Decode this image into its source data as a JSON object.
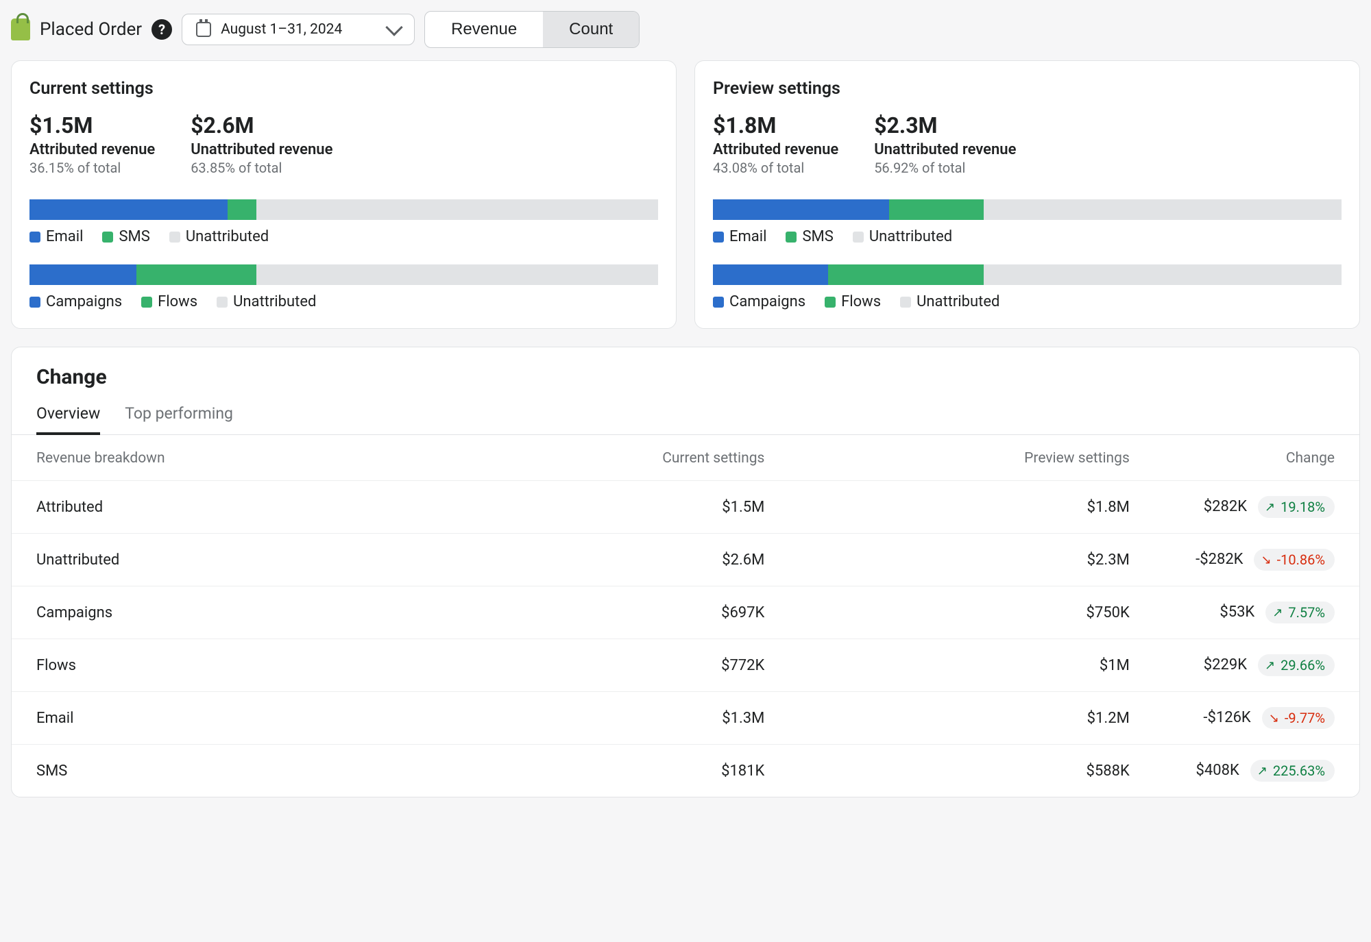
{
  "colors": {
    "blue": "#2c6ecb",
    "green": "#37b26c",
    "gray": "#e1e3e5"
  },
  "header": {
    "brand_label": "Placed Order",
    "date_range": "August 1–31, 2024",
    "segments": {
      "revenue": "Revenue",
      "count": "Count",
      "active": "count"
    }
  },
  "legends": {
    "channel": [
      "Email",
      "SMS",
      "Unattributed"
    ],
    "type": [
      "Campaigns",
      "Flows",
      "Unattributed"
    ]
  },
  "settings_cards": [
    {
      "title": "Current settings",
      "stats": [
        {
          "big": "$1.5M",
          "mid": "Attributed revenue",
          "small": "36.15% of total"
        },
        {
          "big": "$2.6M",
          "mid": "Unattributed revenue",
          "small": "63.85% of total"
        }
      ],
      "channel_bar": {
        "blue": 31.5,
        "green": 4.6
      },
      "type_bar": {
        "blue": 17.0,
        "green": 19.1
      }
    },
    {
      "title": "Preview settings",
      "stats": [
        {
          "big": "$1.8M",
          "mid": "Attributed revenue",
          "small": "43.08% of total"
        },
        {
          "big": "$2.3M",
          "mid": "Unattributed revenue",
          "small": "56.92% of total"
        }
      ],
      "channel_bar": {
        "blue": 28.0,
        "green": 15.1
      },
      "type_bar": {
        "blue": 18.3,
        "green": 24.8
      }
    }
  ],
  "change_panel": {
    "title": "Change",
    "tabs": {
      "overview": "Overview",
      "top": "Top performing",
      "active": "overview"
    },
    "table": {
      "columns": [
        "Revenue breakdown",
        "Current settings",
        "Preview settings",
        "Change"
      ],
      "rows": [
        {
          "label": "Attributed",
          "current": "$1.5M",
          "preview": "$1.8M",
          "diff": "$282K",
          "pct": "19.18%",
          "dir": "up"
        },
        {
          "label": "Unattributed",
          "current": "$2.6M",
          "preview": "$2.3M",
          "diff": "-$282K",
          "pct": "-10.86%",
          "dir": "down"
        },
        {
          "label": "Campaigns",
          "current": "$697K",
          "preview": "$750K",
          "diff": "$53K",
          "pct": "7.57%",
          "dir": "up"
        },
        {
          "label": "Flows",
          "current": "$772K",
          "preview": "$1M",
          "diff": "$229K",
          "pct": "29.66%",
          "dir": "up"
        },
        {
          "label": "Email",
          "current": "$1.3M",
          "preview": "$1.2M",
          "diff": "-$126K",
          "pct": "-9.77%",
          "dir": "down"
        },
        {
          "label": "SMS",
          "current": "$181K",
          "preview": "$588K",
          "diff": "$408K",
          "pct": "225.63%",
          "dir": "up"
        }
      ]
    }
  },
  "chart_data": [
    {
      "type": "bar",
      "stacked": true,
      "orientation": "horizontal",
      "title": "Current settings — channel share of revenue",
      "categories": [
        "Email",
        "SMS",
        "Unattributed"
      ],
      "values_pct": [
        31.5,
        4.6,
        63.9
      ],
      "ylim": [
        0,
        100
      ]
    },
    {
      "type": "bar",
      "stacked": true,
      "orientation": "horizontal",
      "title": "Current settings — campaign/flow share of revenue",
      "categories": [
        "Campaigns",
        "Flows",
        "Unattributed"
      ],
      "values_pct": [
        17.0,
        19.1,
        63.9
      ],
      "ylim": [
        0,
        100
      ]
    },
    {
      "type": "bar",
      "stacked": true,
      "orientation": "horizontal",
      "title": "Preview settings — channel share of revenue",
      "categories": [
        "Email",
        "SMS",
        "Unattributed"
      ],
      "values_pct": [
        28.0,
        15.1,
        56.9
      ],
      "ylim": [
        0,
        100
      ]
    },
    {
      "type": "bar",
      "stacked": true,
      "orientation": "horizontal",
      "title": "Preview settings — campaign/flow share of revenue",
      "categories": [
        "Campaigns",
        "Flows",
        "Unattributed"
      ],
      "values_pct": [
        18.3,
        24.8,
        56.9
      ],
      "ylim": [
        0,
        100
      ]
    },
    {
      "type": "table",
      "title": "Revenue breakdown change",
      "columns": [
        "metric",
        "current",
        "preview",
        "diff",
        "pct"
      ],
      "rows": [
        [
          "Attributed",
          "$1.5M",
          "$1.8M",
          "$282K",
          "19.18%"
        ],
        [
          "Unattributed",
          "$2.6M",
          "$2.3M",
          "-$282K",
          "-10.86%"
        ],
        [
          "Campaigns",
          "$697K",
          "$750K",
          "$53K",
          "7.57%"
        ],
        [
          "Flows",
          "$772K",
          "$1M",
          "$229K",
          "29.66%"
        ],
        [
          "Email",
          "$1.3M",
          "$1.2M",
          "-$126K",
          "-9.77%"
        ],
        [
          "SMS",
          "$181K",
          "$588K",
          "$408K",
          "225.63%"
        ]
      ]
    }
  ]
}
